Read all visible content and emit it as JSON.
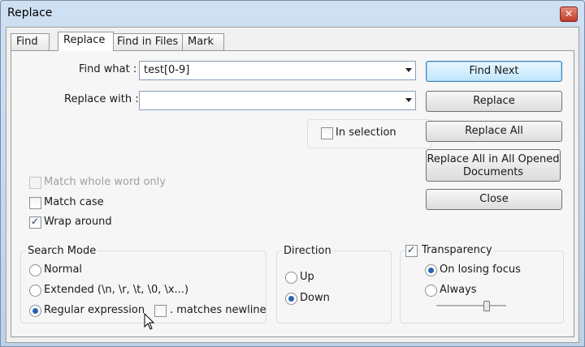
{
  "window": {
    "title": "Replace"
  },
  "tabs": [
    {
      "label": "Find"
    },
    {
      "label": "Replace"
    },
    {
      "label": "Find in Files"
    },
    {
      "label": "Mark"
    }
  ],
  "find": {
    "label": "Find what :",
    "value": "test[0-9]"
  },
  "replace": {
    "label": "Replace with :",
    "value": ""
  },
  "in_selection": {
    "label": "In selection",
    "checked": false
  },
  "buttons": {
    "find_next": "Find Next",
    "replace": "Replace",
    "replace_all": "Replace All",
    "replace_all_opened": "Replace All in All Opened Documents",
    "close": "Close"
  },
  "options": {
    "match_whole_word": {
      "label": "Match whole word only",
      "checked": false,
      "enabled": false
    },
    "match_case": {
      "label": "Match case",
      "checked": false
    },
    "wrap_around": {
      "label": "Wrap around",
      "checked": true
    }
  },
  "search_mode": {
    "title": "Search Mode",
    "normal": "Normal",
    "extended": "Extended (\\n, \\r, \\t, \\0, \\x...)",
    "regex": "Regular expression",
    "matches_newline": ". matches newline",
    "selected": "regex"
  },
  "direction": {
    "title": "Direction",
    "up": "Up",
    "down": "Down",
    "selected": "down"
  },
  "transparency": {
    "label": "Transparency",
    "checked": true,
    "on_losing_focus": "On losing focus",
    "always": "Always",
    "selected": "on_losing_focus"
  }
}
